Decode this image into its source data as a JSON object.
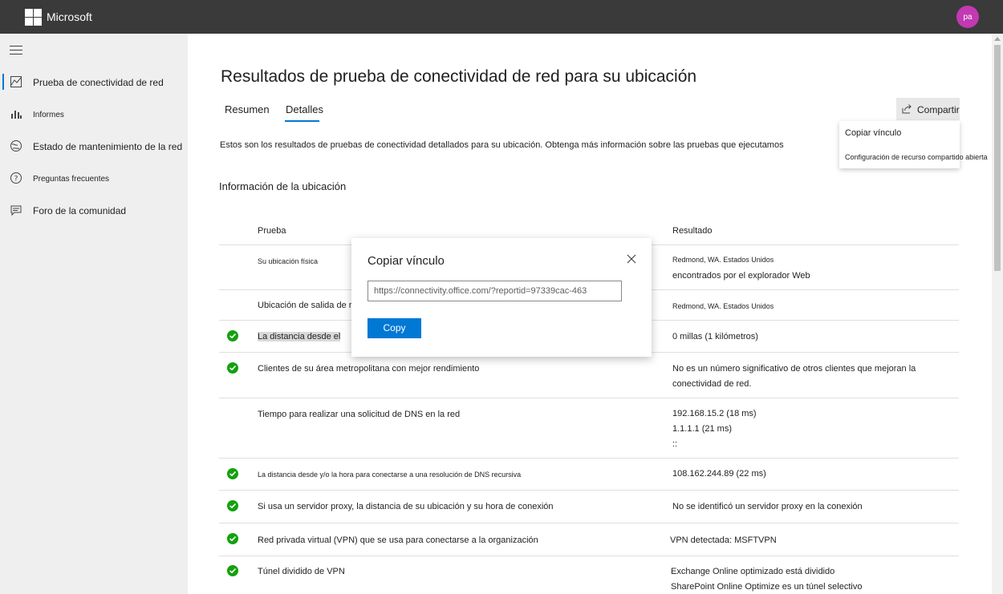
{
  "header": {
    "brand": "Microsoft",
    "avatar_initials": "pa"
  },
  "sidebar": {
    "items": [
      {
        "label": "Prueba de conectividad de red",
        "icon": "chart-area-icon",
        "active": true
      },
      {
        "label": "Informes",
        "icon": "bar-chart-icon"
      },
      {
        "label": "Estado de mantenimiento de la red",
        "icon": "globe-icon"
      },
      {
        "label": "Preguntas frecuentes",
        "icon": "help-circle-icon"
      },
      {
        "label": "Foro de la comunidad",
        "icon": "chat-icon"
      }
    ]
  },
  "main": {
    "title": "Resultados de prueba de conectividad de red para su ubicación",
    "tabs": [
      {
        "label": "Resumen"
      },
      {
        "label": "Detalles",
        "active": true
      }
    ],
    "share_label": "Compartir",
    "share_menu": [
      "Copiar vínculo",
      "Configuración de recurso compartido abierta"
    ],
    "intro": "Estos son los resultados de pruebas de conectividad detallados para su ubicación. Obtenga más información sobre las pruebas que ejecutamos",
    "section_title": "Información de la ubicación",
    "table": {
      "headers": [
        "Prueba",
        "Resultado"
      ],
      "rows": [
        {
          "test": "Su ubicación física",
          "result": [
            "Redmond, WA. Estados Unidos",
            "encontrados por el explorador Web"
          ],
          "status": "none"
        },
        {
          "test": "Ubicación de salida de red",
          "result": [
            "Redmond, WA. Estados Unidos"
          ],
          "status": "none"
        },
        {
          "test": "La distancia desde el",
          "result": [
            "0 millas (1 kilómetros)"
          ],
          "status": "pass"
        },
        {
          "test": "Clientes de su área metropolitana con mejor rendimiento",
          "result": [
            "No es un número significativo de otros clientes que mejoran la",
            "conectividad de red."
          ],
          "status": "pass"
        },
        {
          "test": "Tiempo para realizar una solicitud de DNS en la red",
          "result": [
            "192.168.15.2 (18 ms)",
            "1.1.1.1 (21 ms)",
            "::"
          ],
          "status": "none"
        },
        {
          "test": "La distancia desde y/o la hora para conectarse a una resolución de DNS recursiva",
          "result": [
            "108.162.244.89 (22 ms)"
          ],
          "status": "pass"
        },
        {
          "test": "Si usa un servidor proxy, la distancia de su ubicación y su hora de conexión",
          "result": [
            "No se identificó un servidor proxy en la conexión"
          ],
          "status": "pass"
        },
        {
          "test": "Red privada virtual (VPN) que se usa para conectarse a la organización",
          "result": [
            "VPN detectada: MSFTVPN"
          ],
          "status": "pass"
        },
        {
          "test": "Túnel dividido de VPN",
          "result": [
            "Exchange Online optimizado está dividido",
            "SharePoint Online Optimize es un túnel selectivo"
          ],
          "status": "pass"
        }
      ]
    }
  },
  "dialog": {
    "title": "Copiar vínculo",
    "link_value": "https://connectivity.office.com/?reportid=97339cac-463",
    "copy_label": "Copy"
  },
  "colors": {
    "accent": "#0078d4",
    "success": "#13a10e",
    "topbar": "#3a3a3a",
    "avatar": "#c239b3"
  }
}
